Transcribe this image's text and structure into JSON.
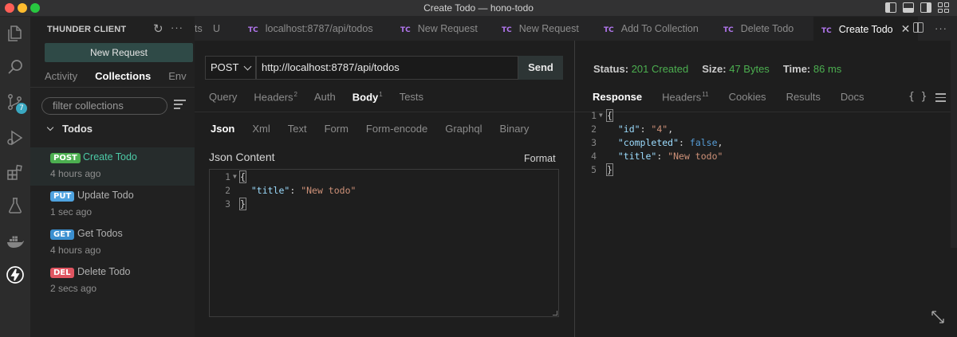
{
  "window": {
    "title": "Create Todo — hono-todo"
  },
  "activity_bar": {
    "source_control_badge": "7"
  },
  "sidebar": {
    "title": "THUNDER CLIENT",
    "new_request_label": "New Request",
    "tabs": [
      "Activity",
      "Collections",
      "Env"
    ],
    "active_tab": "Collections",
    "filter_placeholder": "filter collections",
    "folder": "Todos",
    "requests": [
      {
        "method": "POST",
        "name": "Create Todo",
        "time": "4 hours ago",
        "selected": true
      },
      {
        "method": "PUT",
        "name": "Update Todo",
        "time": "1 sec ago"
      },
      {
        "method": "GET",
        "name": "Get Todos",
        "time": "4 hours ago"
      },
      {
        "method": "DEL",
        "name": "Delete Todo",
        "time": "2 secs ago"
      }
    ]
  },
  "tabs": {
    "partial_left": "ts",
    "partial_u": "U",
    "items": [
      {
        "tc": "TC",
        "label": "localhost:8787/api/todos"
      },
      {
        "tc": "TC",
        "label": "New Request"
      },
      {
        "tc": "TC",
        "label": "New Request"
      },
      {
        "tc": "TC",
        "label": "Add To Collection"
      },
      {
        "tc": "TC",
        "label": "Delete Todo"
      },
      {
        "tc": "TC",
        "label": "Create Todo",
        "active": true
      }
    ]
  },
  "request": {
    "method": "POST",
    "url": "http://localhost:8787/api/todos",
    "send_label": "Send",
    "tabs": [
      {
        "label": "Query"
      },
      {
        "label": "Headers",
        "sup": "2"
      },
      {
        "label": "Auth"
      },
      {
        "label": "Body",
        "sup": "1"
      },
      {
        "label": "Tests"
      }
    ],
    "active_tab": "Body",
    "body_tabs": [
      "Json",
      "Xml",
      "Text",
      "Form",
      "Form-encode",
      "Graphql",
      "Binary"
    ],
    "active_body_tab": "Json",
    "json_label": "Json Content",
    "format_label": "Format",
    "body_lines": {
      "l1": "{",
      "l2_key": "\"title\"",
      "l2_val": "\"New todo\"",
      "l3": "}"
    },
    "line_numbers": [
      "1",
      "2",
      "3"
    ]
  },
  "response": {
    "status_label": "Status:",
    "status_value": "201 Created",
    "size_label": "Size:",
    "size_value": "47 Bytes",
    "time_label": "Time:",
    "time_value": "86 ms",
    "tabs": [
      {
        "label": "Response"
      },
      {
        "label": "Headers",
        "sup": "11"
      },
      {
        "label": "Cookies"
      },
      {
        "label": "Results"
      },
      {
        "label": "Docs"
      }
    ],
    "active_tab": "Response",
    "braces_label": "{ }",
    "line_numbers": [
      "1",
      "2",
      "3",
      "4",
      "5"
    ],
    "lines": {
      "l1": "{",
      "id_key": "\"id\"",
      "id_val": "\"4\"",
      "completed_key": "\"completed\"",
      "completed_val": "false",
      "title_key": "\"title\"",
      "title_val": "\"New todo\"",
      "l5": "}"
    }
  },
  "colors": {
    "accent_green": "#4caf50",
    "post": "#4caf50",
    "put": "#4fa3e0",
    "get": "#3b8fd0",
    "del": "#e05561",
    "tc_purple": "#b377f0"
  },
  "icons": [
    "files-icon",
    "search-icon",
    "source-control-icon",
    "run-debug-icon",
    "extensions-icon",
    "testing-icon",
    "docker-icon",
    "thunder-client-icon"
  ]
}
